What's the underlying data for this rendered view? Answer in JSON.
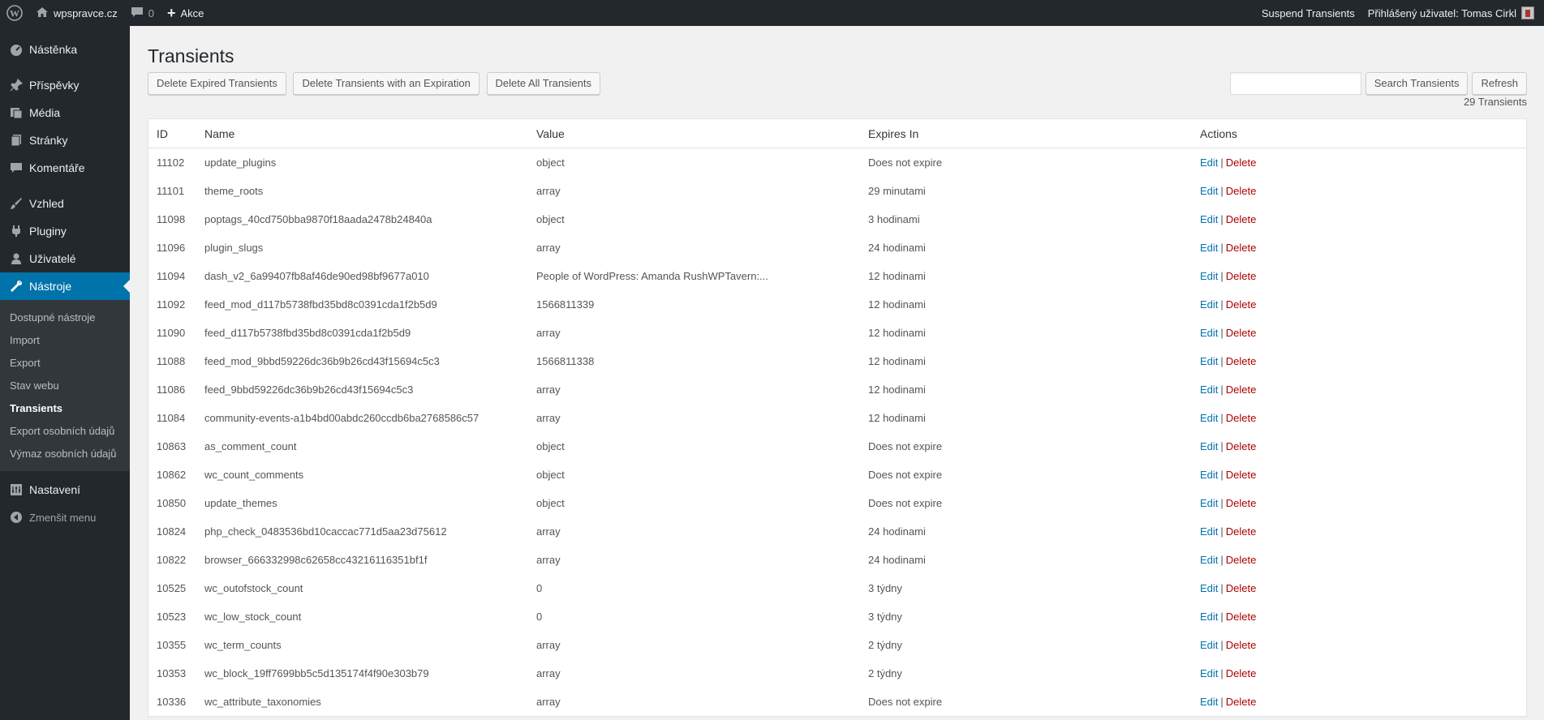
{
  "adminbar": {
    "site_name": "wpspravce.cz",
    "comments_count": "0",
    "new_label": "Akce",
    "suspend_label": "Suspend Transients",
    "user_label": "Přihlášený uživatel: Tomas Cirkl"
  },
  "sidebar": {
    "items": [
      {
        "label": "Nástěnka",
        "icon": "dashboard-icon"
      },
      {
        "label": "Příspěvky",
        "icon": "pin-icon"
      },
      {
        "label": "Média",
        "icon": "media-icon"
      },
      {
        "label": "Stránky",
        "icon": "pages-icon"
      },
      {
        "label": "Komentáře",
        "icon": "comments-icon"
      },
      {
        "label": "Vzhled",
        "icon": "appearance-icon"
      },
      {
        "label": "Pluginy",
        "icon": "plugins-icon"
      },
      {
        "label": "Uživatelé",
        "icon": "users-icon"
      },
      {
        "label": "Nástroje",
        "icon": "tools-icon"
      },
      {
        "label": "Nastavení",
        "icon": "settings-icon"
      }
    ],
    "submenu": [
      "Dostupné nástroje",
      "Import",
      "Export",
      "Stav webu",
      "Transients",
      "Export osobních údajů",
      "Výmaz osobních údajů"
    ],
    "collapse_label": "Zmenšit menu"
  },
  "page": {
    "title": "Transients",
    "buttons": {
      "delete_expired": "Delete Expired Transients",
      "delete_with_expiration": "Delete Transients with an Expiration",
      "delete_all": "Delete All Transients",
      "search": "Search Transients",
      "refresh": "Refresh"
    },
    "search_value": "",
    "count_label": "29 Transients"
  },
  "table": {
    "headers": {
      "id": "ID",
      "name": "Name",
      "value": "Value",
      "expires": "Expires In",
      "actions": "Actions"
    },
    "edit_label": "Edit",
    "delete_label": "Delete",
    "separator": "|",
    "rows": [
      {
        "id": "11102",
        "name": "update_plugins",
        "value": "object",
        "expires": "Does not expire"
      },
      {
        "id": "11101",
        "name": "theme_roots",
        "value": "array",
        "expires": "29 minutami"
      },
      {
        "id": "11098",
        "name": "poptags_40cd750bba9870f18aada2478b24840a",
        "value": "object",
        "expires": "3 hodinami"
      },
      {
        "id": "11096",
        "name": "plugin_slugs",
        "value": "array",
        "expires": "24 hodinami"
      },
      {
        "id": "11094",
        "name": "dash_v2_6a99407fb8af46de90ed98bf9677a010",
        "value": "People of WordPress: Amanda RushWPTavern:...",
        "expires": "12 hodinami"
      },
      {
        "id": "11092",
        "name": "feed_mod_d117b5738fbd35bd8c0391cda1f2b5d9",
        "value": "1566811339",
        "expires": "12 hodinami"
      },
      {
        "id": "11090",
        "name": "feed_d117b5738fbd35bd8c0391cda1f2b5d9",
        "value": "array",
        "expires": "12 hodinami"
      },
      {
        "id": "11088",
        "name": "feed_mod_9bbd59226dc36b9b26cd43f15694c5c3",
        "value": "1566811338",
        "expires": "12 hodinami"
      },
      {
        "id": "11086",
        "name": "feed_9bbd59226dc36b9b26cd43f15694c5c3",
        "value": "array",
        "expires": "12 hodinami"
      },
      {
        "id": "11084",
        "name": "community-events-a1b4bd00abdc260ccdb6ba2768586c57",
        "value": "array",
        "expires": "12 hodinami"
      },
      {
        "id": "10863",
        "name": "as_comment_count",
        "value": "object",
        "expires": "Does not expire"
      },
      {
        "id": "10862",
        "name": "wc_count_comments",
        "value": "object",
        "expires": "Does not expire"
      },
      {
        "id": "10850",
        "name": "update_themes",
        "value": "object",
        "expires": "Does not expire"
      },
      {
        "id": "10824",
        "name": "php_check_0483536bd10caccac771d5aa23d75612",
        "value": "array",
        "expires": "24 hodinami"
      },
      {
        "id": "10822",
        "name": "browser_666332998c62658cc43216116351bf1f",
        "value": "array",
        "expires": "24 hodinami"
      },
      {
        "id": "10525",
        "name": "wc_outofstock_count",
        "value": "0",
        "expires": "3 týdny"
      },
      {
        "id": "10523",
        "name": "wc_low_stock_count",
        "value": "0",
        "expires": "3 týdny"
      },
      {
        "id": "10355",
        "name": "wc_term_counts",
        "value": "array",
        "expires": "2 týdny"
      },
      {
        "id": "10353",
        "name": "wc_block_19ff7699bb5c5d135174f4f90e303b79",
        "value": "array",
        "expires": "2 týdny"
      },
      {
        "id": "10336",
        "name": "wc_attribute_taxonomies",
        "value": "array",
        "expires": "Does not expire"
      }
    ]
  }
}
